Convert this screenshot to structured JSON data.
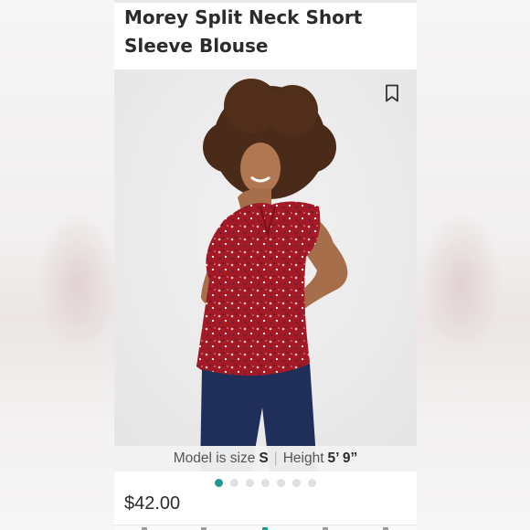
{
  "listing": {
    "title_line1": "Morey Split Neck Short",
    "title_line2": "Sleeve Blouse",
    "price": "$42.00"
  },
  "photo": {
    "caption_prefix": "Model is size",
    "size": "S",
    "separator": "|",
    "height_label": "Height",
    "height_value": "5’ 9”",
    "bookmark_icon": "bookmark-icon",
    "carousel_count": 7,
    "carousel_active": 1
  },
  "colors": {
    "accent": "#1e9a92",
    "blouse": "#a31a26"
  }
}
